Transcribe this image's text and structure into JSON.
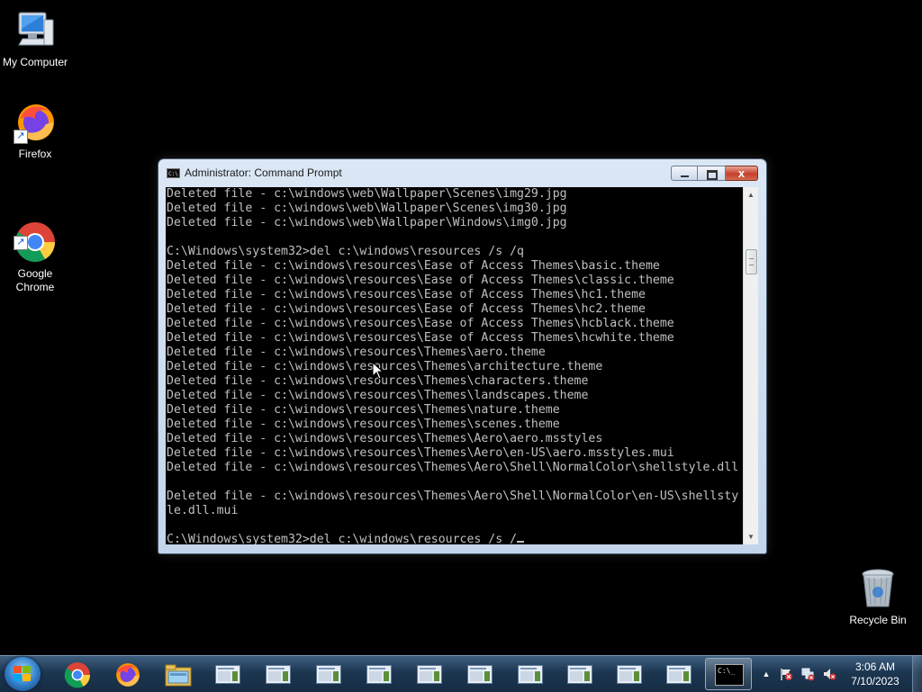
{
  "desktop": {
    "icons": [
      {
        "label": "My Computer"
      },
      {
        "label": "Firefox"
      },
      {
        "label": "Google\nChrome"
      },
      {
        "label": "Recycle Bin"
      }
    ]
  },
  "window": {
    "title": "Administrator:  Command Prompt",
    "icon_text": "C:\\",
    "close_glyph": "x",
    "lines": [
      "Deleted file - c:\\windows\\web\\Wallpaper\\Scenes\\img29.jpg",
      "Deleted file - c:\\windows\\web\\Wallpaper\\Scenes\\img30.jpg",
      "Deleted file - c:\\windows\\web\\Wallpaper\\Windows\\img0.jpg",
      "",
      "C:\\Windows\\system32>del c:\\windows\\resources /s /q",
      "Deleted file - c:\\windows\\resources\\Ease of Access Themes\\basic.theme",
      "Deleted file - c:\\windows\\resources\\Ease of Access Themes\\classic.theme",
      "Deleted file - c:\\windows\\resources\\Ease of Access Themes\\hc1.theme",
      "Deleted file - c:\\windows\\resources\\Ease of Access Themes\\hc2.theme",
      "Deleted file - c:\\windows\\resources\\Ease of Access Themes\\hcblack.theme",
      "Deleted file - c:\\windows\\resources\\Ease of Access Themes\\hcwhite.theme",
      "Deleted file - c:\\windows\\resources\\Themes\\aero.theme",
      "Deleted file - c:\\windows\\resources\\Themes\\architecture.theme",
      "Deleted file - c:\\windows\\resources\\Themes\\characters.theme",
      "Deleted file - c:\\windows\\resources\\Themes\\landscapes.theme",
      "Deleted file - c:\\windows\\resources\\Themes\\nature.theme",
      "Deleted file - c:\\windows\\resources\\Themes\\scenes.theme",
      "Deleted file - c:\\windows\\resources\\Themes\\Aero\\aero.msstyles",
      "Deleted file - c:\\windows\\resources\\Themes\\Aero\\en-US\\aero.msstyles.mui",
      "Deleted file - c:\\windows\\resources\\Themes\\Aero\\Shell\\NormalColor\\shellstyle.dll",
      "",
      "Deleted file - c:\\windows\\resources\\Themes\\Aero\\Shell\\NormalColor\\en-US\\shellsty",
      "le.dll.mui",
      ""
    ],
    "prompt_line": "C:\\Windows\\system32>del c:\\windows\\resources /s /"
  },
  "taskbar": {
    "cmd_thumb_text": "C:\\_",
    "tray_expand_glyph": "▲",
    "clock_time": "3:06 AM",
    "clock_date": "7/10/2023"
  },
  "colors": {
    "console_bg": "#000000",
    "console_text": "#c0c0c0",
    "close_button": "#c6402b"
  }
}
